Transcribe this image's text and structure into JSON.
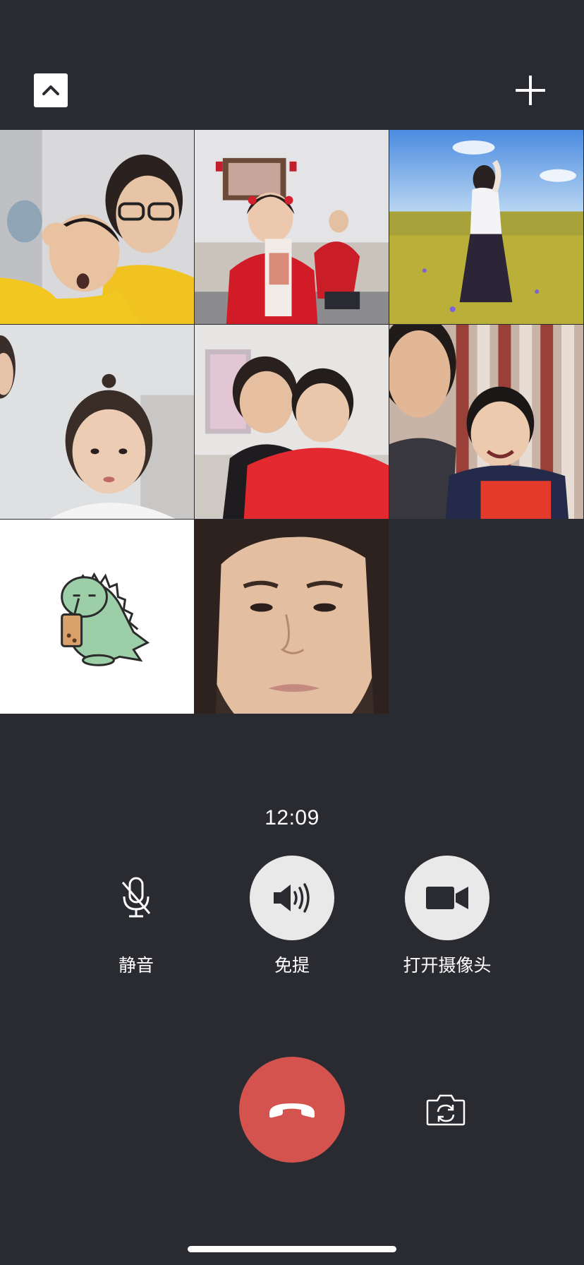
{
  "call": {
    "duration": "12:09"
  },
  "top_bar": {
    "collapse_icon": "chevron-up-icon",
    "add_icon": "plus-icon"
  },
  "participants": [
    {
      "tile": "video",
      "icon": "video-feed"
    },
    {
      "tile": "video",
      "icon": "video-feed"
    },
    {
      "tile": "video",
      "icon": "video-feed"
    },
    {
      "tile": "video",
      "icon": "video-feed"
    },
    {
      "tile": "video",
      "icon": "video-feed"
    },
    {
      "tile": "video",
      "icon": "video-feed"
    },
    {
      "tile": "avatar",
      "icon": "dinosaur-avatar"
    },
    {
      "tile": "video",
      "icon": "video-feed"
    }
  ],
  "controls": {
    "mute": {
      "label": "静音",
      "icon": "microphone-off-icon",
      "active": false
    },
    "speaker": {
      "label": "免提",
      "icon": "speaker-icon",
      "active": true
    },
    "camera": {
      "label": "打开摄像头",
      "icon": "video-camera-icon",
      "active": true
    }
  },
  "bottom": {
    "hangup_icon": "hangup-phone-icon",
    "flip_icon": "switch-camera-icon"
  },
  "colors": {
    "background": "#2a2b31",
    "hangup": "#d4534f",
    "active_button": "#e9e9e9"
  }
}
